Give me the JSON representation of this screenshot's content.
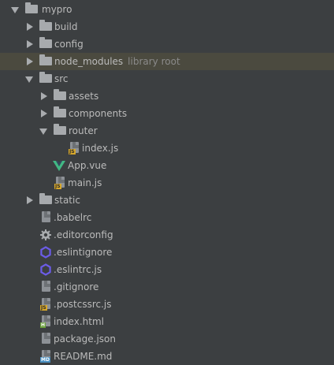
{
  "project_tree": {
    "root": {
      "label": "mypro",
      "icon": "folder-icon",
      "expanded": true
    },
    "items": [
      {
        "label": "build",
        "icon": "folder-icon",
        "expanded": false
      },
      {
        "label": "config",
        "icon": "folder-icon",
        "expanded": false
      },
      {
        "label": "node_modules",
        "note": "library root",
        "icon": "folder-icon",
        "expanded": false,
        "highlighted": true
      },
      {
        "label": "src",
        "icon": "folder-icon",
        "expanded": true
      },
      {
        "label": "assets",
        "icon": "folder-icon",
        "expanded": false
      },
      {
        "label": "components",
        "icon": "folder-icon",
        "expanded": false
      },
      {
        "label": "router",
        "icon": "folder-icon",
        "expanded": true
      },
      {
        "label": "index.js",
        "icon": "js-file-icon"
      },
      {
        "label": "App.vue",
        "icon": "vue-file-icon"
      },
      {
        "label": "main.js",
        "icon": "js-file-icon"
      },
      {
        "label": "static",
        "icon": "folder-icon",
        "expanded": false
      },
      {
        "label": ".babelrc",
        "icon": "text-file-icon"
      },
      {
        "label": ".editorconfig",
        "icon": "gear-icon"
      },
      {
        "label": ".eslintignore",
        "icon": "eslint-icon"
      },
      {
        "label": ".eslintrc.js",
        "icon": "eslint-icon"
      },
      {
        "label": ".gitignore",
        "icon": "text-file-icon"
      },
      {
        "label": ".postcssrc.js",
        "icon": "js-file-icon"
      },
      {
        "label": "index.html",
        "icon": "html-file-icon"
      },
      {
        "label": "package.json",
        "icon": "json-file-icon"
      },
      {
        "label": "README.md",
        "icon": "markdown-file-icon"
      }
    ]
  },
  "colors": {
    "background": "#3c3f41",
    "highlight_row": "#4b4a3f",
    "text": "#bbbbbb",
    "note_text": "#8a8a8a",
    "vue_green": "#41b883",
    "eslint_purple": "#6b5ce7"
  }
}
